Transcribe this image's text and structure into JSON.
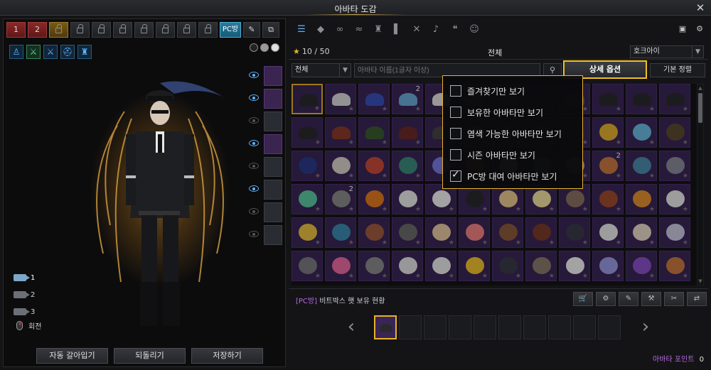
{
  "window": {
    "title": "아바타 도감",
    "close_icon": "✕"
  },
  "slots": [
    {
      "label": "1",
      "kind": "red"
    },
    {
      "label": "2",
      "kind": "red"
    },
    {
      "label": "lock",
      "kind": "gold"
    },
    {
      "label": "lock",
      "kind": "normal"
    },
    {
      "label": "lock",
      "kind": "normal"
    },
    {
      "label": "lock",
      "kind": "normal"
    },
    {
      "label": "lock",
      "kind": "normal"
    },
    {
      "label": "lock",
      "kind": "normal"
    },
    {
      "label": "lock",
      "kind": "normal"
    },
    {
      "label": "lock",
      "kind": "normal"
    }
  ],
  "pc_slot_label": "PC방",
  "tool_icons": [
    "edit-icon",
    "copy-icon"
  ],
  "part_icons": [
    "body-icon",
    "weapon-swap-icon",
    "sword-icon",
    "helmet-icon",
    "armor-icon"
  ],
  "color_dots": [
    "#222222",
    "#9a9a9a",
    "#e0e0e0"
  ],
  "side_rows": [
    {
      "visible": true,
      "slot": "purple"
    },
    {
      "visible": true,
      "slot": "purple"
    },
    {
      "visible": false,
      "slot": "dark"
    },
    {
      "visible": true,
      "slot": "purple"
    },
    {
      "visible": false,
      "slot": "dark"
    },
    {
      "visible": true,
      "slot": "dark"
    },
    {
      "visible": false,
      "slot": "dark"
    },
    {
      "visible": false,
      "slot": "dark"
    }
  ],
  "cameras": [
    {
      "label": "1",
      "active": true
    },
    {
      "label": "2",
      "active": false
    },
    {
      "label": "3",
      "active": false
    }
  ],
  "rotate_label": "회전",
  "bottom_buttons": [
    "자동 갈아입기",
    "되돌리기",
    "저장하기"
  ],
  "categories": [
    "list-icon",
    "hat-icon",
    "glasses-icon",
    "mustache-icon",
    "coat-icon",
    "pants-icon",
    "crossed-swords-icon",
    "guitar-icon",
    "footprints-icon",
    "face-icon"
  ],
  "category_glyphs": [
    "☰",
    "◆",
    "∞",
    "≈",
    "♜",
    "▌",
    "✕",
    "♪",
    "❝",
    "☺"
  ],
  "category_right_icons": [
    "screenshot-icon",
    "settings-icon"
  ],
  "list": {
    "count": "10 / 50",
    "title": "전체",
    "server": "호크아이"
  },
  "filter": {
    "type": "전체",
    "search_placeholder": "아바타 이름(1글자 이상)",
    "detail_label": "상세 옵션",
    "sort_label": "기본 정렬"
  },
  "dropdown_options": [
    {
      "label": "즐겨찾기만 보기",
      "checked": false
    },
    {
      "label": "보유한 아바타만 보기",
      "checked": false
    },
    {
      "label": "염색 가능한 아바타만 보기",
      "checked": false
    },
    {
      "label": "시즌 아바타만 보기",
      "checked": false
    },
    {
      "label": "PC방 대여 아바타만 보기",
      "checked": true
    }
  ],
  "grid": {
    "cols": 12,
    "rows": 6,
    "items": [
      {
        "c": "#2a2a2e",
        "s": "hat",
        "sel": true
      },
      {
        "c": "#d8d8dc",
        "s": "hat"
      },
      {
        "c": "#3a4fb8",
        "s": "hat"
      },
      {
        "c": "#6aa8d8",
        "s": "hat",
        "num": "2"
      },
      {
        "c": "#e0e0e0",
        "s": "hat"
      },
      {
        "c": "#5a5f6a",
        "s": "hat"
      },
      {
        "c": "#7a4a30",
        "s": "hat"
      },
      {
        "c": "#444",
        "s": "hat"
      },
      {
        "c": "#555a66",
        "s": "hat"
      },
      {
        "c": "#2a2a2e",
        "s": "hat"
      },
      {
        "c": "#2a2a2e",
        "s": "hat"
      },
      {
        "c": "#2a2a2e",
        "s": "hat"
      },
      {
        "c": "#2a2a2e",
        "s": "hat"
      },
      {
        "c": "#8a3a2a",
        "s": "hat"
      },
      {
        "c": "#3a5a30",
        "s": "hat"
      },
      {
        "c": "#6a2a2a",
        "s": "hat"
      },
      {
        "c": "#444",
        "s": "hat"
      },
      {
        "c": "#8a6a40",
        "s": "hat"
      },
      {
        "c": "#553355",
        "s": "hat"
      },
      {
        "c": "#666",
        "s": "hat"
      },
      {
        "c": "#3a3a50",
        "s": "hat"
      },
      {
        "c": "#e0b030",
        "s": "face"
      },
      {
        "c": "#6ab8e0",
        "s": "face"
      },
      {
        "c": "#5a4a30",
        "s": "face"
      },
      {
        "c": "#2a3a8a",
        "s": "face"
      },
      {
        "c": "#d8d0c8",
        "s": "face"
      },
      {
        "c": "#c84a3a",
        "s": "face"
      },
      {
        "c": "#3a8a7a",
        "s": "face"
      },
      {
        "c": "#7a7ae0",
        "s": "face"
      },
      {
        "c": "#d88a30",
        "s": "face"
      },
      {
        "c": "#cfcfcf",
        "s": "face"
      },
      {
        "c": "#8ab84a",
        "s": "face"
      },
      {
        "c": "#aaa",
        "s": "face"
      },
      {
        "c": "#c87a40",
        "s": "face",
        "num": "2"
      },
      {
        "c": "#4a8aa8",
        "s": "face"
      },
      {
        "c": "#8a8a9a",
        "s": "face"
      },
      {
        "c": "#5ac8a0",
        "s": "face"
      },
      {
        "c": "#8a8a8a",
        "s": "face",
        "num": "2"
      },
      {
        "c": "#e07a20",
        "s": "face"
      },
      {
        "c": "#e8e8e8",
        "s": "face"
      },
      {
        "c": "#f0f0f0",
        "s": "face"
      },
      {
        "c": "#2a2a2e",
        "s": "face"
      },
      {
        "c": "#e8c890",
        "s": "face"
      },
      {
        "c": "#f0e0a0",
        "s": "face"
      },
      {
        "c": "#8a7060",
        "s": "face"
      },
      {
        "c": "#a04a30",
        "s": "face"
      },
      {
        "c": "#e09030",
        "s": "face"
      },
      {
        "c": "#e8e8e8",
        "s": "face"
      },
      {
        "c": "#e8c040",
        "s": "face"
      },
      {
        "c": "#3a8ab0",
        "s": "face"
      },
      {
        "c": "#a05a40",
        "s": "face"
      },
      {
        "c": "#6a6a6a",
        "s": "face"
      },
      {
        "c": "#e8c8a0",
        "s": "face"
      },
      {
        "c": "#f08080",
        "s": "face"
      },
      {
        "c": "#8a5a3a",
        "s": "face"
      },
      {
        "c": "#7a3a2a",
        "s": "face"
      },
      {
        "c": "#3a3a4a",
        "s": "face"
      },
      {
        "c": "#e8e8e8",
        "s": "face"
      },
      {
        "c": "#e8d8c8",
        "s": "face"
      },
      {
        "c": "#c8c8e0",
        "s": "face"
      },
      {
        "c": "#7a7a80",
        "s": "face"
      },
      {
        "c": "#e86aa0",
        "s": "face"
      },
      {
        "c": "#8a8a8a",
        "s": "face"
      },
      {
        "c": "#e0e0e0",
        "s": "face"
      },
      {
        "c": "#e8e8e8",
        "s": "face"
      },
      {
        "c": "#f0c030",
        "s": "face"
      },
      {
        "c": "#3a3a4a",
        "s": "face"
      },
      {
        "c": "#8a7a6a",
        "s": "face"
      },
      {
        "c": "#f0f0f0",
        "s": "face"
      },
      {
        "c": "#9a9ae0",
        "s": "face"
      },
      {
        "c": "#8a50c8",
        "s": "face"
      },
      {
        "c": "#c87a40",
        "s": "face"
      }
    ]
  },
  "status": {
    "pc_tag": "[PC방]",
    "text": "비트박스 햇 보유 현황"
  },
  "shop_icons": [
    "cart-icon",
    "box-icon",
    "dye-icon",
    "hammer-icon",
    "tools-icon",
    "trade-icon"
  ],
  "shop_glyphs": [
    "🛒",
    "⚙",
    "✎",
    "⚒",
    "✂",
    "⇄"
  ],
  "preview": {
    "count": 10,
    "active_index": 0
  },
  "points": {
    "label": "아바타 포인트",
    "value": "0"
  }
}
